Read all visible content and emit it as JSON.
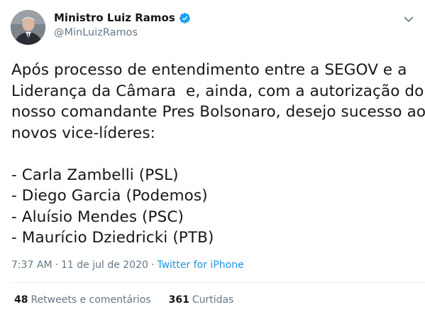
{
  "author": {
    "name": "Ministro Luiz Ramos",
    "handle": "@MinLuizRamos",
    "verified_color": "#1da1f2"
  },
  "tweet": {
    "lines": [
      "Após processo de entendimento entre a SEGOV e a",
      "Liderança da Câmara  e, ainda, com a autorização do",
      "nosso comandante Pres Bolsonaro, desejo sucesso aos",
      "novos vice-líderes:",
      "",
      "- Carla Zambelli (PSL)",
      "- Diego Garcia (Podemos)",
      "- Aluísio Mendes (PSC)",
      "- Maurício Dziedricki (PTB)"
    ]
  },
  "meta": {
    "time": "7:37 AM",
    "separator": "·",
    "date": "11 de jul de 2020",
    "separator2": "·",
    "source": "Twitter for iPhone"
  },
  "stats": {
    "retweets_count": "48",
    "retweets_label": "Retweets e comentários",
    "likes_count": "361",
    "likes_label": "Curtidas"
  },
  "icons": {
    "verified": "verified-badge-icon",
    "menu": "chevron-down-icon"
  }
}
